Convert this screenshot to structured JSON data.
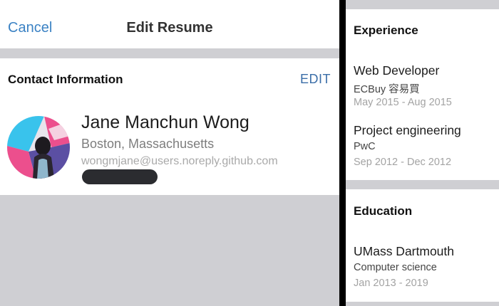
{
  "resume": {
    "nav": {
      "cancel": "Cancel",
      "title": "Edit Resume"
    },
    "contact": {
      "title": "Contact Information",
      "edit": "EDIT",
      "name": "Jane Manchun Wong",
      "location": "Boston, Massachusetts",
      "email": "wongmjane@users.noreply.github.com"
    }
  },
  "details": {
    "experience": {
      "title": "Experience",
      "items": [
        {
          "role": "Web Developer",
          "org": "ECBuy 容易買",
          "dates": "May 2015 - Aug 2015"
        },
        {
          "role": "Project engineering",
          "org": "PwC",
          "dates": "Sep 2012 - Dec 2012"
        }
      ]
    },
    "education": {
      "title": "Education",
      "items": [
        {
          "school": "UMass Dartmouth",
          "field": "Computer science",
          "dates": "Jan 2013 - 2019"
        }
      ]
    }
  },
  "colors": {
    "link_blue": "#3b82c4",
    "background_gray": "#cfcfd3",
    "avatar_cyan": "#39c3ec",
    "avatar_pink": "#ec4f8d",
    "avatar_purple": "#5b4fa3"
  }
}
